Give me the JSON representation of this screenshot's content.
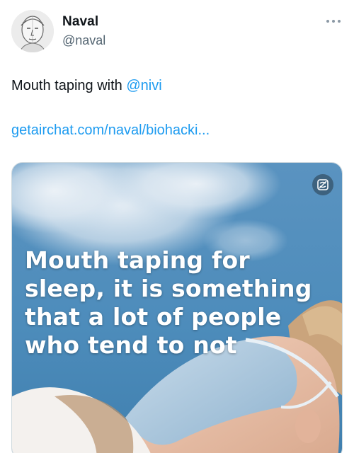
{
  "author": {
    "name": "Naval",
    "handle": "@naval",
    "avatar_icon": "avatar-sketch"
  },
  "more_icon": "more-horizontal-icon",
  "tweet": {
    "text_before": "Mouth taping with ",
    "mention": "@nivi",
    "link": "getairchat.com/naval/biohacki..."
  },
  "media": {
    "caption_lines": [
      "Mouth taping for",
      "sleep, it is something",
      "that a lot of people",
      "who tend to not"
    ],
    "badge_icon": "airchat-badge-icon"
  },
  "colors": {
    "accent": "#1d9bf0",
    "text": "#0f1419",
    "secondary": "#536471"
  }
}
